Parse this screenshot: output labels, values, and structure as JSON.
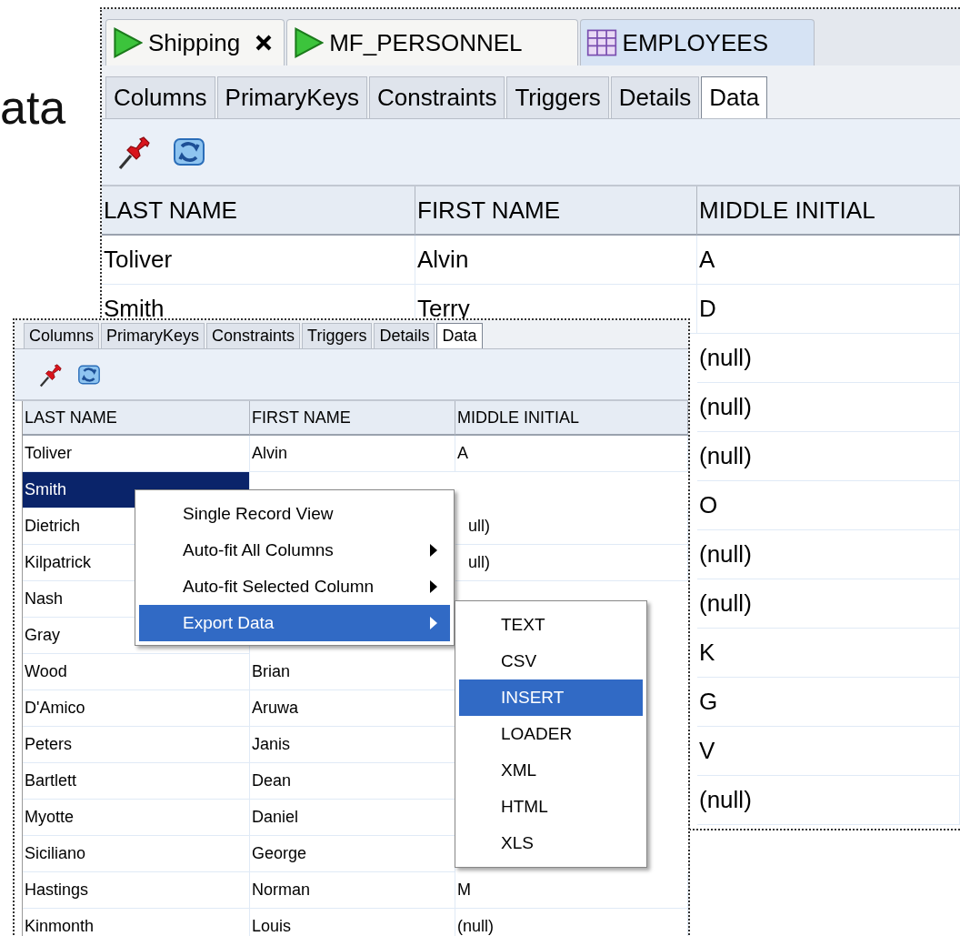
{
  "slide_title_fragment": "ata",
  "main_view": {
    "editor_tabs": [
      {
        "label": "Shipping",
        "kind": "procedure",
        "closable": true,
        "selected": false
      },
      {
        "label": "MF_PERSONNEL",
        "kind": "procedure",
        "closable": false,
        "selected": false
      },
      {
        "label": "EMPLOYEES",
        "kind": "table",
        "closable": false,
        "selected": true
      }
    ],
    "object_tabs": [
      {
        "label": "Columns",
        "selected": false
      },
      {
        "label": "PrimaryKeys",
        "selected": false
      },
      {
        "label": "Constraints",
        "selected": false
      },
      {
        "label": "Triggers",
        "selected": false
      },
      {
        "label": "Details",
        "selected": false
      },
      {
        "label": "Data",
        "selected": true
      }
    ],
    "table": {
      "columns": [
        "LAST NAME",
        "FIRST NAME",
        "MIDDLE INITIAL"
      ],
      "rows": [
        {
          "last_name": "Toliver",
          "first_name": "Alvin",
          "middle_initial": "A"
        },
        {
          "last_name": "Smith",
          "first_name": "Terry",
          "middle_initial": "D"
        },
        {
          "middle_initial": "(null)"
        },
        {
          "middle_initial": "(null)"
        },
        {
          "middle_initial": "(null)"
        },
        {
          "middle_initial": "O"
        },
        {
          "middle_initial": "(null)"
        },
        {
          "middle_initial": "(null)"
        },
        {
          "middle_initial": "K"
        },
        {
          "middle_initial": "G"
        },
        {
          "middle_initial": "V"
        },
        {
          "middle_initial": "(null)"
        }
      ]
    }
  },
  "inset_view": {
    "object_tabs": [
      {
        "label": "Columns",
        "selected": false
      },
      {
        "label": "PrimaryKeys",
        "selected": false
      },
      {
        "label": "Constraints",
        "selected": false
      },
      {
        "label": "Triggers",
        "selected": false
      },
      {
        "label": "Details",
        "selected": false
      },
      {
        "label": "Data",
        "selected": true
      }
    ],
    "table": {
      "columns": [
        "LAST NAME",
        "FIRST NAME",
        "MIDDLE INITIAL"
      ],
      "rows": [
        {
          "last_name": "Toliver",
          "first_name": "Alvin",
          "middle_initial": "A",
          "selected": false
        },
        {
          "last_name": "Smith",
          "selected": true
        },
        {
          "last_name": "Dietrich",
          "middle_initial": "ull)",
          "middle_cut": true,
          "selected": false
        },
        {
          "last_name": "Kilpatrick",
          "middle_initial": "ull)",
          "middle_cut": true,
          "selected": false
        },
        {
          "last_name": "Nash",
          "selected": false
        },
        {
          "last_name": "Gray",
          "selected": false
        },
        {
          "last_name": "Wood",
          "first_name": "Brian",
          "selected": false
        },
        {
          "last_name": "D'Amico",
          "first_name": "Aruwa",
          "selected": false
        },
        {
          "last_name": "Peters",
          "first_name": "Janis",
          "selected": false
        },
        {
          "last_name": "Bartlett",
          "first_name": "Dean",
          "selected": false
        },
        {
          "last_name": "Myotte",
          "first_name": "Daniel",
          "selected": false
        },
        {
          "last_name": "Siciliano",
          "first_name": "George",
          "selected": false
        },
        {
          "last_name": "Hastings",
          "first_name": "Norman",
          "middle_initial": "M",
          "selected": false
        },
        {
          "last_name": "Kinmonth",
          "first_name": "Louis",
          "middle_initial": "(null)",
          "selected": false
        }
      ]
    },
    "context_menu": [
      {
        "label": "Single Record View",
        "submenu": false,
        "selected": false
      },
      {
        "label": "Auto-fit All Columns",
        "submenu": true,
        "selected": false
      },
      {
        "label": "Auto-fit Selected Column",
        "submenu": true,
        "selected": false
      },
      {
        "label": "Export Data",
        "submenu": true,
        "selected": true
      }
    ],
    "export_submenu": [
      {
        "label": "TEXT",
        "selected": false
      },
      {
        "label": "CSV",
        "selected": false
      },
      {
        "label": "INSERT",
        "selected": true
      },
      {
        "label": "LOADER",
        "selected": false
      },
      {
        "label": "XML",
        "selected": false
      },
      {
        "label": "HTML",
        "selected": false
      },
      {
        "label": "XLS",
        "selected": false
      }
    ]
  }
}
